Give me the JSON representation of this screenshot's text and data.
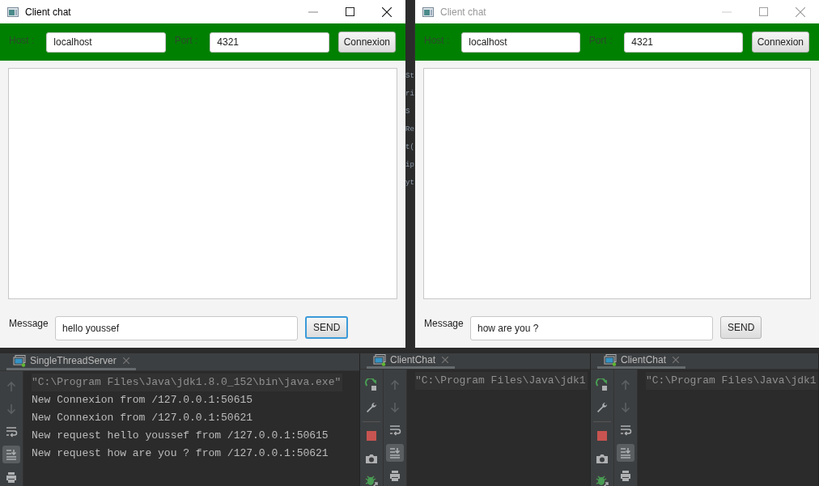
{
  "windows": [
    {
      "title": "Client chat",
      "active": true,
      "host_label": "Host :",
      "host": "localhost",
      "port_label": "Port :",
      "port": "4321",
      "connect_button": "Connexion",
      "message_label": "Message",
      "message": "hello youssef",
      "send_button": "SEND",
      "send_focused": true
    },
    {
      "title": "Client chat",
      "active": false,
      "host_label": "Host :",
      "host": "localhost",
      "port_label": "Port :",
      "port": "4321",
      "connect_button": "Connexion",
      "message_label": "Message",
      "message": "how are you ?",
      "send_button": "SEND",
      "send_focused": false
    }
  ],
  "background_code": [
    "St",
    "ri",
    "S",
    "Re",
    "t(",
    "ip",
    "yt"
  ],
  "run_panels": [
    {
      "tab": {
        "label": "SingleThreadServer",
        "selected": true
      },
      "tools": [
        {
          "kind": "up",
          "disabled": true,
          "on": false
        },
        {
          "kind": "down",
          "disabled": true,
          "on": false
        },
        {
          "kind": "wrap",
          "disabled": false,
          "on": false
        },
        {
          "kind": "scroll-end",
          "disabled": false,
          "on": true
        },
        {
          "kind": "print",
          "disabled": false,
          "on": false
        }
      ],
      "lines": [
        {
          "kind": "command",
          "text": "\"C:\\Program Files\\Java\\jdk1.8.0_152\\bin\\java.exe\""
        },
        {
          "kind": "output",
          "text": "New Connexion from /127.0.0.1:50615"
        },
        {
          "kind": "output",
          "text": "New Connexion from /127.0.0.1:50621"
        },
        {
          "kind": "output",
          "text": "New request hello youssef from /127.0.0.1:50615"
        },
        {
          "kind": "output",
          "text": "New request how are you ? from /127.0.0.1:50621"
        }
      ]
    },
    {
      "tab": {
        "label": "ClientChat",
        "selected": true
      },
      "run_tools": [
        {
          "kind": "rerun"
        },
        {
          "kind": "settings"
        },
        {
          "kind": "stop"
        },
        {
          "kind": "dump"
        },
        {
          "kind": "debug"
        }
      ],
      "tools": [
        {
          "kind": "up",
          "disabled": true,
          "on": false
        },
        {
          "kind": "down",
          "disabled": true,
          "on": false
        },
        {
          "kind": "wrap",
          "disabled": false,
          "on": false
        },
        {
          "kind": "scroll-end",
          "disabled": false,
          "on": true
        },
        {
          "kind": "print",
          "disabled": false,
          "on": false
        }
      ],
      "lines": [
        {
          "kind": "command",
          "text": "\"C:\\Program Files\\Java\\jdk1"
        }
      ]
    },
    {
      "tab": {
        "label": "ClientChat",
        "selected": true
      },
      "run_tools": [
        {
          "kind": "rerun"
        },
        {
          "kind": "settings"
        },
        {
          "kind": "stop"
        },
        {
          "kind": "dump"
        },
        {
          "kind": "debug"
        }
      ],
      "tools": [
        {
          "kind": "up",
          "disabled": true,
          "on": false
        },
        {
          "kind": "down",
          "disabled": true,
          "on": false
        },
        {
          "kind": "wrap",
          "disabled": false,
          "on": false
        },
        {
          "kind": "scroll-end",
          "disabled": false,
          "on": true
        },
        {
          "kind": "print",
          "disabled": false,
          "on": false
        }
      ],
      "lines": [
        {
          "kind": "command",
          "text": "\"C:\\Program Files\\Java\\jdk1"
        }
      ]
    }
  ]
}
